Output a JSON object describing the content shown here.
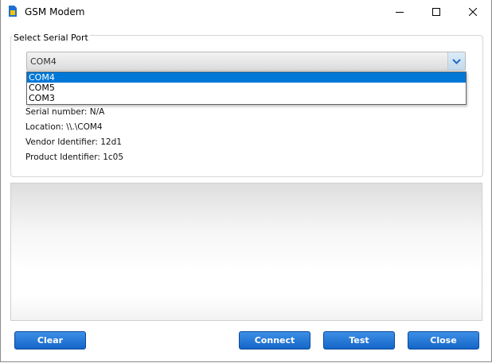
{
  "window": {
    "title": "GSM Modem"
  },
  "group": {
    "legend": "Select Serial Port"
  },
  "port_select": {
    "value": "COM4",
    "options": [
      "COM4",
      "COM5",
      "COM3"
    ],
    "selected_index": 0
  },
  "info": {
    "serial_number": "Serial number: N/A",
    "location": "Location: \\\\.\\COM4",
    "vendor_identifier": "Vendor Identifier: 12d1",
    "product_identifier": "Product Identifier: 1c05"
  },
  "buttons": {
    "clear": "Clear",
    "connect": "Connect",
    "test": "Test",
    "close": "Close"
  },
  "colors": {
    "accent": "#1466c8",
    "selection": "#0078d7"
  }
}
